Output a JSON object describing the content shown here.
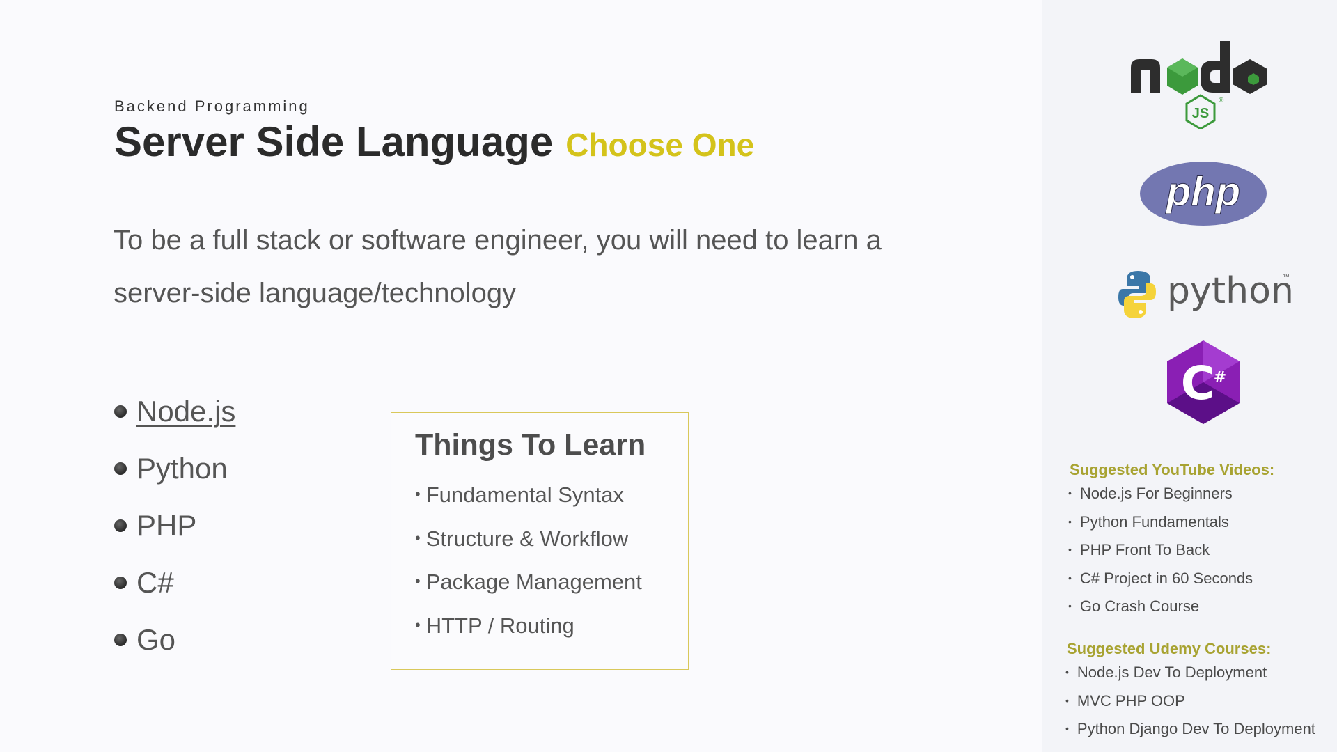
{
  "slide": {
    "kicker": "Backend Programming",
    "title": "Server Side Language",
    "title_accent": "Choose One",
    "intro": "To be a full stack or software engineer, you will need to learn a server-side language/technology"
  },
  "languages": [
    {
      "label": "Node.js",
      "is_link": true
    },
    {
      "label": "Python",
      "is_link": false
    },
    {
      "label": "PHP",
      "is_link": false
    },
    {
      "label": "C#",
      "is_link": false
    },
    {
      "label": "Go",
      "is_link": false
    }
  ],
  "learn_box": {
    "title": "Things To Learn",
    "bullet": "•",
    "items": [
      "Fundamental Syntax",
      "Structure & Workflow",
      "Package Management",
      "HTTP / Routing"
    ]
  },
  "logos": {
    "node": {
      "icon": "nodejs-logo",
      "text": "node",
      "badge": "JS",
      "mark": "®"
    },
    "php": {
      "icon": "php-logo",
      "text": "php"
    },
    "python": {
      "icon": "python-logo",
      "text": "python",
      "mark": "™"
    },
    "csharp": {
      "icon": "csharp-logo",
      "text": "C",
      "mark": "#"
    }
  },
  "suggestions": {
    "bullet": "•",
    "youtube": {
      "heading": "Suggested YouTube Videos:",
      "items": [
        "Node.js For Beginners",
        "Python Fundamentals",
        "PHP Front To Back",
        "C# Project in 60 Seconds",
        "Go Crash Course"
      ]
    },
    "udemy": {
      "heading": "Suggested Udemy Courses:",
      "items": [
        "Node.js Dev To Deployment",
        "MVC PHP OOP",
        "Python Django Dev To Deployment"
      ]
    }
  },
  "colors": {
    "accent": "#d4c31b",
    "suggestion_heading": "#a8a332",
    "box_border": "#d9c85a",
    "node_green": "#3c9a3c",
    "php_purple": "#7377b1",
    "python_blue": "#3b77a8",
    "python_yellow": "#f5d33a",
    "csharp_purple": "#8a1fb4"
  }
}
